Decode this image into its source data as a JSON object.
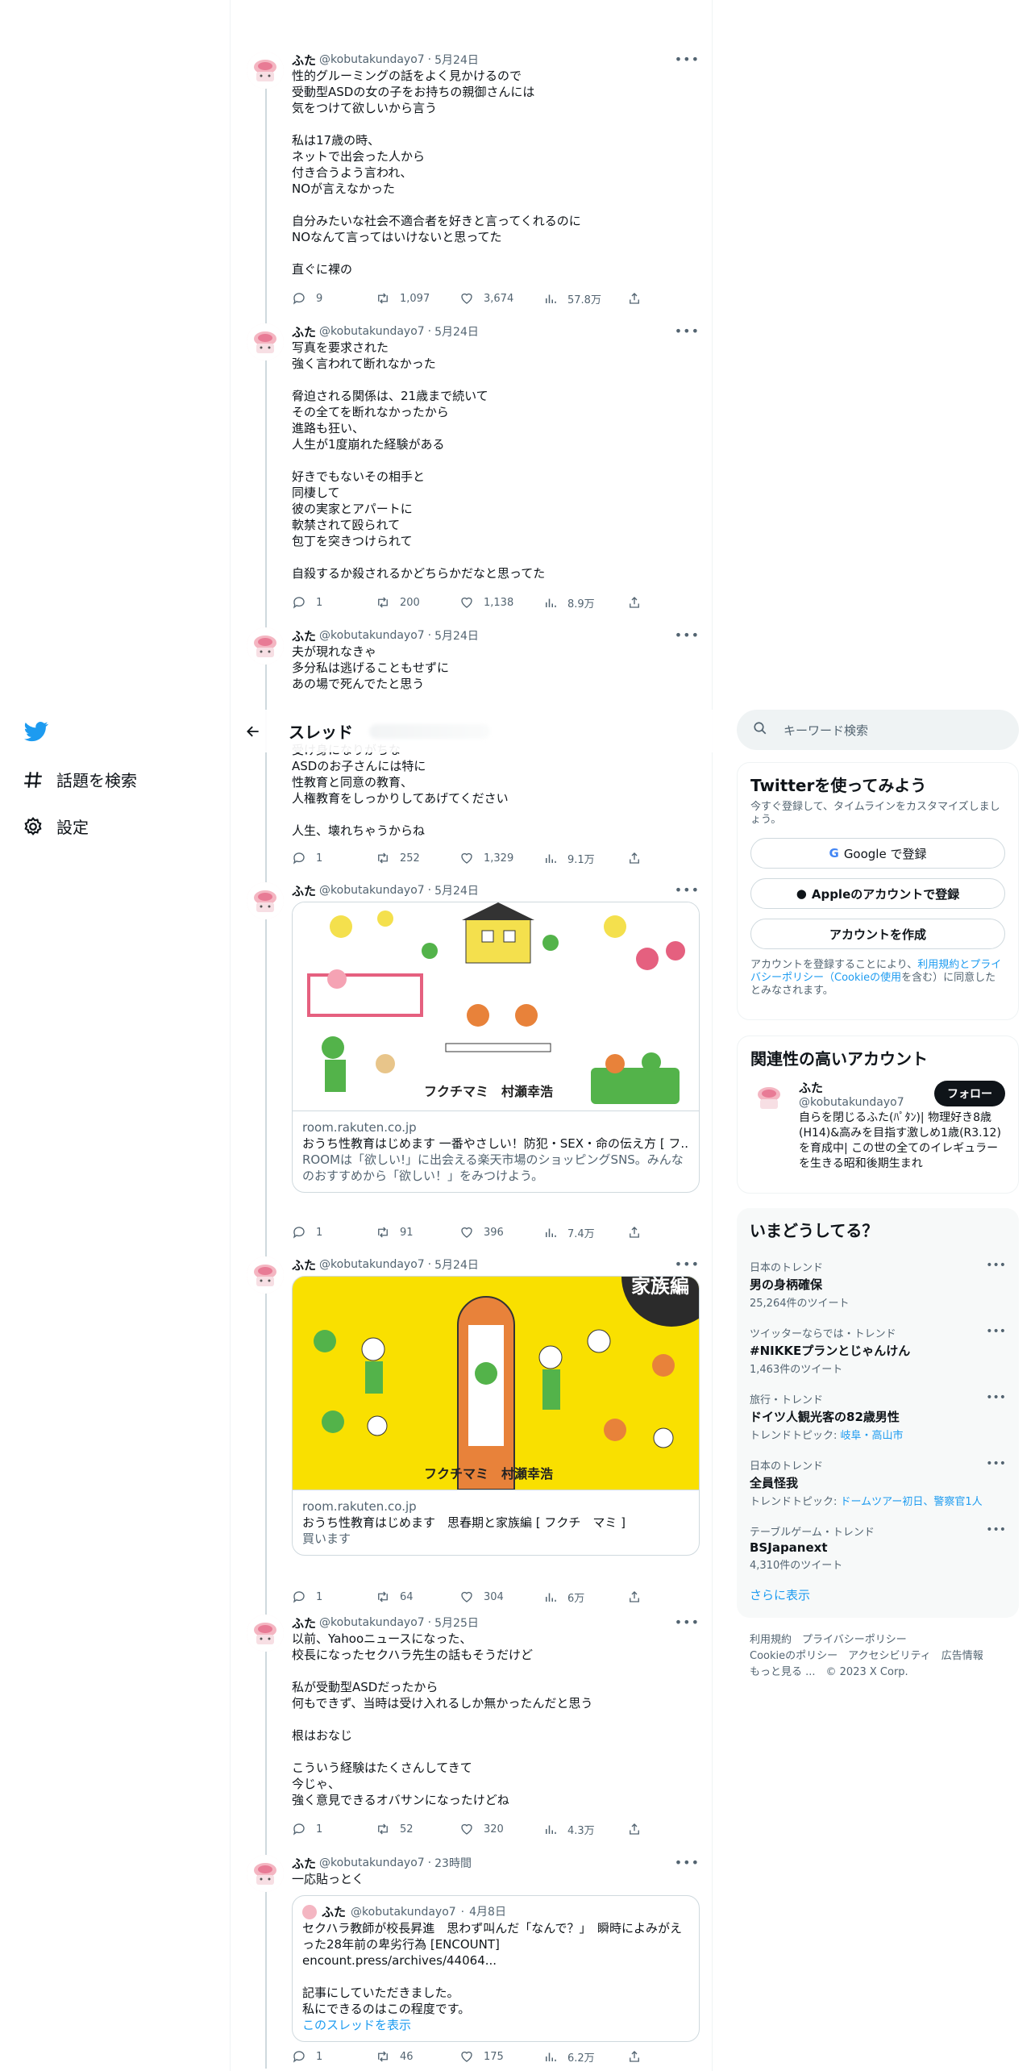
{
  "nav": {
    "settings_label": "設定",
    "explore_label": "話題を検索"
  },
  "header": {
    "title": "スレッド"
  },
  "tweets": [
    {
      "name": "ふた",
      "handle": "@kobutakundayo7",
      "date": "5月24日",
      "text": "性的グルーミングの話をよく見かけるので\n受動型ASDの女の子をお持ちの親御さんには\n気をつけて欲しいから言う\n\n私は17歳の時、\nネットで出会った人から\n付き合うよう言われ、\nNOが言えなかった\n\n自分みたいな社会不適合者を好きと言ってくれるのに\nNOなんて言ってはいけないと思ってた\n\n直ぐに裸の",
      "replies": "9",
      "retweets": "1,097",
      "likes": "3,674",
      "views": "57.8万"
    },
    {
      "name": "ふた",
      "handle": "@kobutakundayo7",
      "date": "5月24日",
      "text": "写真を要求された\n強く言われて断れなかった\n\n脅迫される関係は、21歳まで続いて\nその全てを断れなかったから\n進路も狂い、\n人生が1度崩れた経験がある\n\n好きでもないその相手と\n同棲して\n彼の実家とアパートに\n軟禁されて殴られて\n包丁を突きつけられて\n\n自殺するか殺されるかどちらかだなと思ってた",
      "replies": "1",
      "retweets": "200",
      "likes": "1,138",
      "views": "8.9万"
    },
    {
      "name": "ふた",
      "handle": "@kobutakundayo7",
      "date": "5月24日",
      "text": "夫が現れなきゃ\n多分私は逃げることもせずに\nあの場で死んでたと思う",
      "text2": "受け身になりがちな\nASDのお子さんには特に\n性教育と同意の教育、\n人権教育をしっかりしてあげてください\n\n人生、壊れちゃうからね",
      "replies": "1",
      "retweets": "252",
      "likes": "1,329",
      "views": "9.1万"
    },
    {
      "name": "ふた",
      "handle": "@kobutakundayo7",
      "date": "5月24日",
      "card": {
        "domain": "room.rakuten.co.jp",
        "title": "おうち性教育はじめます 一番やさしい！防犯・SEX・命の伝え方 [ フ...",
        "desc": "ROOMは「欲しい!」に出会える楽天市場のショッピングSNS。みんなのおすすめから「欲しい！」をみつけよう。",
        "authors": "フクチマミ　村瀬幸浩"
      },
      "replies": "1",
      "retweets": "91",
      "likes": "396",
      "views": "7.4万"
    },
    {
      "name": "ふた",
      "handle": "@kobutakundayo7",
      "date": "5月24日",
      "card": {
        "domain": "room.rakuten.co.jp",
        "title": "おうち性教育はじめます　思春期と家族編 [ フクチ　マミ ]",
        "desc": "買います",
        "authors": "フクチマミ　村瀬幸浩",
        "badge": "家族編"
      },
      "replies": "1",
      "retweets": "64",
      "likes": "304",
      "views": "6万"
    },
    {
      "name": "ふた",
      "handle": "@kobutakundayo7",
      "date": "5月25日",
      "text": "以前、Yahooニュースになった、\n校長になったセクハラ先生の話もそうだけど\n\n私が受動型ASDだったから\n何もできず、当時は受け入れるしか無かったんだと思う\n\n根はおなじ\n\nこういう経験はたくさんしてきて\n今じゃ、\n強く意見できるオバサンになったけどね",
      "replies": "1",
      "retweets": "52",
      "likes": "320",
      "views": "4.3万"
    },
    {
      "name": "ふた",
      "handle": "@kobutakundayo7",
      "date": "23時間",
      "text": "一応貼っとく",
      "quote": {
        "name": "ふた",
        "handle": "@kobutakundayo7",
        "date": "4月8日",
        "text": "セクハラ教師が校長昇進　思わず叫んだ「なんで？」　瞬時によみがえった28年前の卑劣行為 [ENCOUNT] encount.press/archives/44064...\n\n記事にしていただきました。\n私にできるのはこの程度です。",
        "link": "このスレッドを表示"
      },
      "replies": "1",
      "retweets": "46",
      "likes": "175",
      "views": "6.2万"
    }
  ],
  "right": {
    "search_placeholder": "キーワード検索",
    "signup": {
      "title": "Twitterを使ってみよう",
      "subtitle": "今すぐ登録して、タイムラインをカスタマイズしましょう。",
      "google": "Google で登録",
      "apple": "Appleのアカウントで登録",
      "create": "アカウントを作成",
      "terms_pre": "アカウントを登録することにより、",
      "terms_link": "利用規約とプライバシーポリシー（Cookieの使用",
      "terms_post": "を含む）に同意したとみなされます。"
    },
    "related": {
      "title": "関連性の高いアカウント",
      "name": "ふた",
      "handle": "@kobutakundayo7",
      "follow": "フォロー",
      "bio": "自らを閉じるふた(ﾊﾟﾀﾝ)| 物理好き8歳(H14)&高みを目指す激しめ1歳(R3.12)を育成中| この世の全てのイレギュラーを生きる昭和後期生まれ"
    },
    "trends_title": "いまどうしてる？",
    "trends": [
      {
        "context": "日本のトレンド",
        "name": "男の身柄確保",
        "sub": "25,264件のツイート"
      },
      {
        "context": "ツイッターならでは・トレンド",
        "name": "#NIKKEプランとじゃんけん",
        "sub": "1,463件のツイート"
      },
      {
        "context": "旅行・トレンド",
        "name": "ドイツ人観光客の82歳男性",
        "sub_pre": "トレンドトピック: ",
        "sub_link": "岐阜・高山市"
      },
      {
        "context": "日本のトレンド",
        "name": "全員怪我",
        "sub_pre": "トレンドトピック: ",
        "sub_link": "ドームツアー初日、警察官1人"
      },
      {
        "context": "テーブルゲーム・トレンド",
        "name": "BSJapanext",
        "sub": "4,310件のツイート"
      }
    ],
    "show_more": "さらに表示",
    "footer": {
      "l1": "利用規約　プライバシーポリシー",
      "l2": "Cookieのポリシー　アクセシビリティ　広告情報",
      "l3": "もっと見る ...　© 2023 X Corp."
    }
  }
}
